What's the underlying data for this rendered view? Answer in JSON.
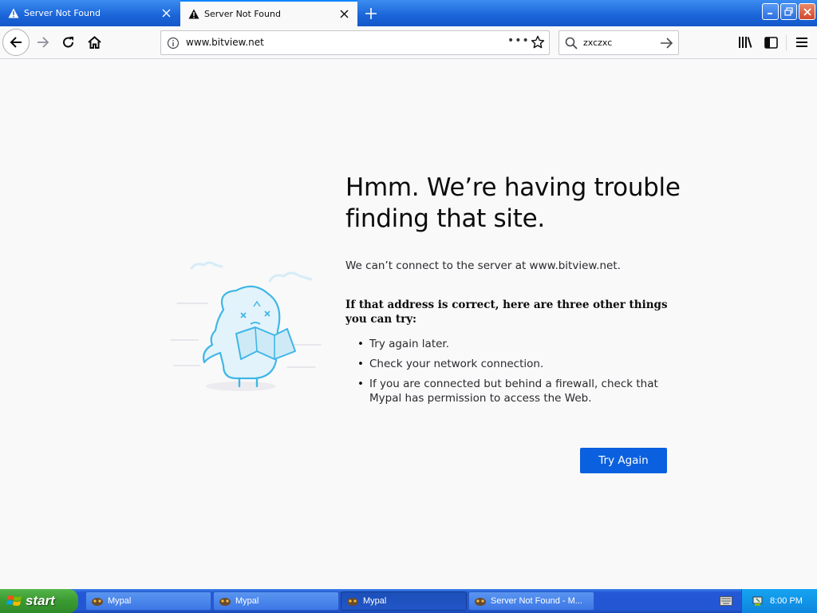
{
  "tabs": [
    {
      "title": "Server Not Found",
      "active": false
    },
    {
      "title": "Server Not Found",
      "active": true
    }
  ],
  "toolbar": {
    "url": "www.bitview.net",
    "page_actions": "•••",
    "search_value": "zxczxc"
  },
  "error": {
    "title": "Hmm. We’re having trouble finding that site.",
    "short_desc": "We can’t connect to the server at www.bitview.net.",
    "long_title": "If that address is correct, here are three other things you can try:",
    "suggestions": [
      "Try again later.",
      "Check your network connection.",
      "If you are connected but behind a firewall, check that Mypal has permission to access the Web."
    ],
    "button_label": "Try Again"
  },
  "taskbar": {
    "start_label": "start",
    "tasks": [
      {
        "label": "Mypal",
        "active": false
      },
      {
        "label": "Mypal",
        "active": false
      },
      {
        "label": "Mypal",
        "active": true
      },
      {
        "label": "Server Not Found - M...",
        "active": false
      }
    ],
    "clock": "8:00 PM"
  },
  "colors": {
    "accent": "#0a60df",
    "tab_highlight": "#0a84ff",
    "page_bg": "#f9f9fa",
    "illustration": "#3fb7e6"
  }
}
